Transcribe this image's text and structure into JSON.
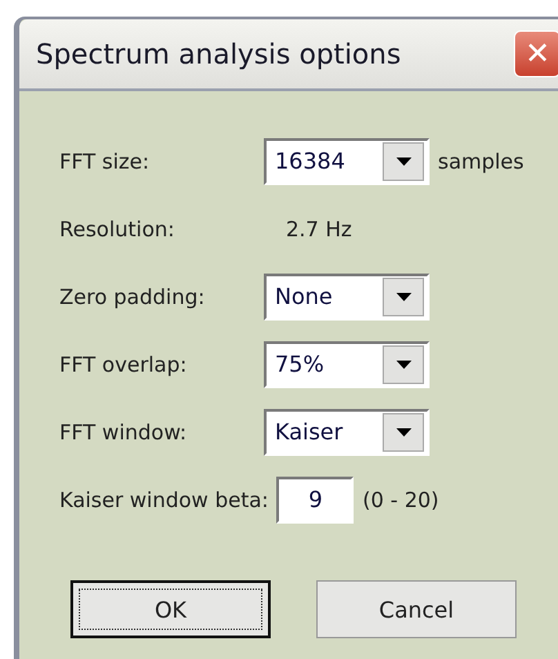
{
  "window": {
    "title": "Spectrum analysis options",
    "close": "✕"
  },
  "rows": [
    {
      "kind": "dropdown",
      "label": "FFT size:",
      "value": "16384",
      "suffix": "samples"
    },
    {
      "kind": "readout",
      "label": "Resolution:",
      "value": "2.7 Hz"
    },
    {
      "kind": "dropdown",
      "label": "Zero padding:",
      "value": "None"
    },
    {
      "kind": "dropdown",
      "label": "FFT overlap:",
      "value": "75%"
    },
    {
      "kind": "dropdown",
      "label": "FFT window:",
      "value": "Kaiser"
    },
    {
      "kind": "number",
      "label": "Kaiser window beta:",
      "value": "9",
      "suffix": "(0 - 20)"
    }
  ],
  "buttons": [
    {
      "label": "OK",
      "focused": true
    },
    {
      "label": "Cancel",
      "focused": false
    }
  ]
}
